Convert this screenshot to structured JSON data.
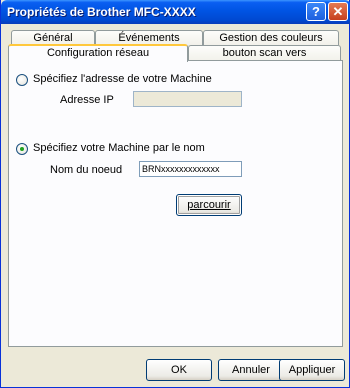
{
  "window": {
    "title": "Propriétés de Brother  MFC-XXXX"
  },
  "titlebar": {
    "help_glyph": "?",
    "close_glyph": "✕"
  },
  "tabs": {
    "row1": [
      {
        "label": "Général"
      },
      {
        "label": "Événements"
      },
      {
        "label": "Gestion des couleurs"
      }
    ],
    "row2": [
      {
        "label": "Configuration réseau",
        "active": true
      },
      {
        "label": "bouton scan vers"
      }
    ]
  },
  "panel": {
    "option_address": {
      "label": "Spécifiez l'adresse de votre Machine",
      "checked": false
    },
    "ip_label": "Adresse IP",
    "ip_value": "",
    "option_name": {
      "label": "Spécifiez votre Machine par le nom",
      "checked": true
    },
    "node_label": "Nom du noeud",
    "node_value": "BRNxxxxxxxxxxxxx",
    "browse_button": "parcourir"
  },
  "buttons": {
    "ok": "OK",
    "cancel": "Annuler",
    "apply": "Appliquer"
  },
  "colors": {
    "titlebar": "#0054e3",
    "dialog_bg": "#ece9d8",
    "panel_bg": "#fcfcfe",
    "tab_highlight": "#ffc83c",
    "radio_dot": "#21a121"
  }
}
